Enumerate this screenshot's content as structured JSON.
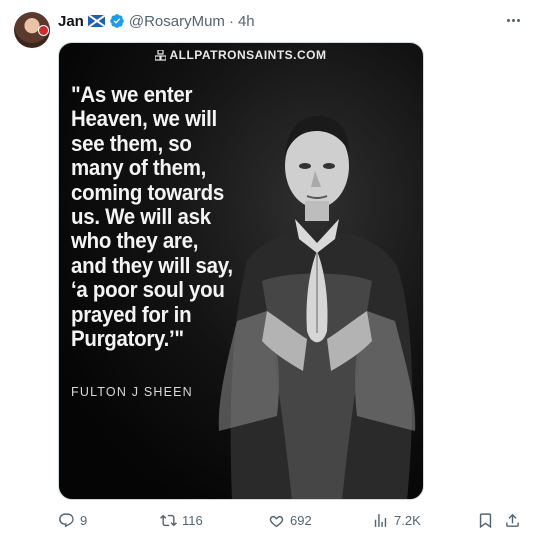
{
  "tweet": {
    "author_name": "Jan",
    "handle": "@RosaryMum",
    "separator": "·",
    "time": "4h"
  },
  "media": {
    "brand": "ALLPATRONSAINTS.COM",
    "quote": "\"As we enter Heaven, we will see them, so many of them, coming towards us. We will ask who they are, and they will say, ‘a poor soul you prayed for in Purgatory.’\"",
    "author": "FULTON J SHEEN"
  },
  "actions": {
    "replies": "9",
    "reposts": "116",
    "likes": "692",
    "views": "7.2K"
  },
  "icons": {
    "verified": "verified-badge-icon",
    "flag": "scotland-flag-icon",
    "more": "more-options-icon",
    "reply": "reply-icon",
    "repost": "repost-icon",
    "like": "heart-icon",
    "views": "analytics-icon",
    "bookmark": "bookmark-icon",
    "share": "share-icon"
  },
  "colors": {
    "text": "#0f1419",
    "muted": "#536471",
    "verified": "#1d9bf0"
  }
}
